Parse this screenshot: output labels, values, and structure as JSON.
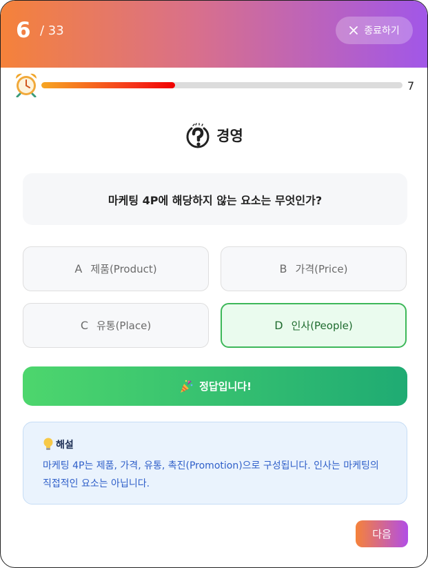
{
  "header": {
    "current_question": "6",
    "total": "/ 33",
    "exit_label": "종료하기",
    "exit_icon": "close-icon"
  },
  "timer": {
    "icon": "alarm-clock-icon",
    "remaining_seconds": "7",
    "progress_fraction": 0.37
  },
  "category": {
    "icon": "quiz-question-icon",
    "label": "경영"
  },
  "question": {
    "text": "마케팅 4P에 해당하지 않는 요소는 무엇인가?"
  },
  "options": [
    {
      "letter": "A",
      "text": "제품(Product)",
      "state": "default"
    },
    {
      "letter": "B",
      "text": "가격(Price)",
      "state": "default"
    },
    {
      "letter": "C",
      "text": "유통(Place)",
      "state": "default"
    },
    {
      "letter": "D",
      "text": "인사(People)",
      "state": "correct"
    }
  ],
  "result": {
    "icon": "party-popper-icon",
    "text": "정답입니다!"
  },
  "explanation": {
    "icon": "lightbulb-icon",
    "title": "해설",
    "line1": "마케팅 4P는 제품, 가격, 유통, 촉진(Promotion)으로 구성됩니다. 인사는 마케팅의",
    "line2": "직접적인 요소는 아닙니다."
  },
  "next_label": "다음",
  "colors": {
    "header_gradient_start": "#f5823a",
    "header_gradient_end": "#a157e8",
    "correct_green": "#3cb758",
    "explain_text_blue": "#2f5fc9"
  }
}
